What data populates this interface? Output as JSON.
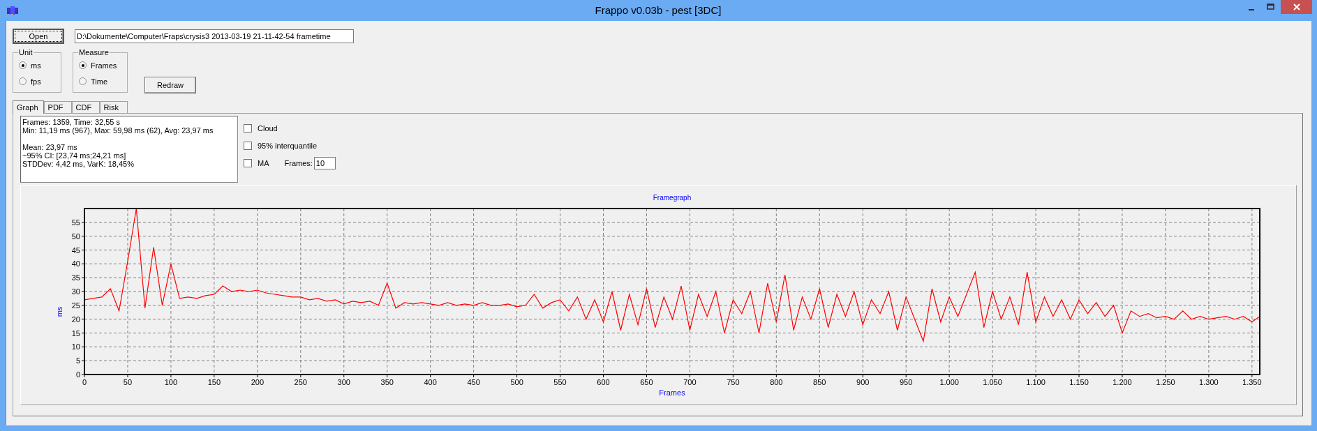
{
  "window": {
    "title": "Frappo v0.03b - pest [3DC]"
  },
  "open_button": {
    "label": "Open"
  },
  "file_path": {
    "value": "D:\\Dokumente\\Computer\\Fraps\\crysis3 2013-03-19 21-11-42-54 frametime"
  },
  "groups": [
    {
      "title": "Unit",
      "options": [
        {
          "label": "ms",
          "selected": true
        },
        {
          "label": "fps",
          "selected": false
        }
      ]
    },
    {
      "title": "Measure",
      "options": [
        {
          "label": "Frames",
          "selected": true
        },
        {
          "label": "Time",
          "selected": false
        }
      ]
    }
  ],
  "redraw_button": {
    "label": "Redraw"
  },
  "tabs": [
    {
      "label": "Graph",
      "selected": true
    },
    {
      "label": "PDF",
      "selected": false
    },
    {
      "label": "CDF",
      "selected": false
    },
    {
      "label": "Risk",
      "selected": false
    }
  ],
  "stats": {
    "blocks": [
      {
        "lines": [
          "Frames: 1359, Time: 32,55 s",
          "Min: 11,19 ms (967), Max: 59,98 ms (62), Avg: 23,97 ms"
        ]
      },
      {
        "lines": [
          "Mean: 23,97 ms",
          "~95% CI: [23,74 ms;24,21 ms]",
          "STDDev: 4,42 ms, VarK: 18,45%"
        ]
      }
    ]
  },
  "options": [
    {
      "label": "Cloud",
      "checked": false
    },
    {
      "label": "95% interquantile",
      "checked": false
    },
    {
      "label": "MA",
      "checked": false
    }
  ],
  "ma_frames": {
    "label": "Frames:",
    "value": "10"
  },
  "chart": {
    "chart_data": {
      "type": "line",
      "title": "Framegraph",
      "xlabel": "Frames",
      "ylabel": "ms",
      "x": [
        0,
        10,
        20,
        30,
        40,
        50,
        60,
        70,
        80,
        90,
        100,
        110,
        120,
        130,
        140,
        150,
        160,
        170,
        180,
        190,
        200,
        210,
        220,
        230,
        240,
        250,
        260,
        270,
        280,
        290,
        300,
        310,
        320,
        330,
        340,
        350,
        360,
        370,
        380,
        390,
        400,
        410,
        420,
        430,
        440,
        450,
        460,
        470,
        480,
        490,
        500,
        510,
        520,
        530,
        540,
        550,
        560,
        570,
        580,
        590,
        600,
        610,
        620,
        630,
        640,
        650,
        660,
        670,
        680,
        690,
        700,
        710,
        720,
        730,
        740,
        750,
        760,
        770,
        780,
        790,
        800,
        810,
        820,
        830,
        840,
        850,
        860,
        870,
        880,
        890,
        900,
        910,
        920,
        930,
        940,
        950,
        960,
        970,
        980,
        990,
        1000,
        1010,
        1020,
        1030,
        1040,
        1050,
        1060,
        1070,
        1080,
        1090,
        1100,
        1110,
        1120,
        1130,
        1140,
        1150,
        1160,
        1170,
        1180,
        1190,
        1200,
        1210,
        1220,
        1230,
        1240,
        1250,
        1260,
        1270,
        1280,
        1290,
        1300,
        1310,
        1320,
        1330,
        1340,
        1350,
        1359
      ],
      "series": [
        {
          "color": "#ff0000",
          "values": [
            27,
            27.5,
            28,
            31,
            23,
            41,
            60,
            24,
            46,
            25,
            40,
            27.5,
            28,
            27.5,
            28.5,
            29,
            32,
            30,
            30.5,
            30,
            30.5,
            29.5,
            29,
            28.5,
            28,
            28,
            27,
            27.5,
            26.5,
            27,
            25.5,
            26.5,
            26,
            26.5,
            25,
            33,
            24,
            26,
            25.5,
            26,
            25.5,
            25,
            26,
            25,
            25.5,
            25,
            26,
            25,
            25,
            25.5,
            24.5,
            25,
            29,
            24,
            26,
            27,
            23,
            28,
            20,
            27,
            19,
            30,
            16,
            29,
            18,
            31,
            17,
            28,
            20,
            32,
            16,
            29,
            21,
            30,
            15,
            27,
            22,
            30,
            15,
            33,
            19,
            36,
            16,
            28,
            20,
            31,
            17,
            29,
            21,
            30,
            18,
            27,
            22,
            30,
            16,
            28,
            20,
            12,
            31,
            19,
            28,
            21,
            29,
            37,
            17,
            30,
            20,
            28,
            18,
            37,
            19,
            28,
            21,
            27,
            20,
            27,
            22,
            26,
            21,
            25,
            15,
            23,
            21,
            22,
            20.5,
            21,
            20,
            23,
            20,
            21,
            20,
            20.5,
            21,
            20,
            21,
            19,
            21
          ]
        }
      ],
      "xlim": [
        0,
        1359
      ],
      "ylim": [
        0,
        60
      ],
      "grid": true,
      "xticks": [
        0,
        50,
        100,
        150,
        200,
        250,
        300,
        350,
        400,
        450,
        500,
        550,
        600,
        650,
        700,
        750,
        800,
        850,
        900,
        950,
        {
          "value": 1000,
          "label": "1.000"
        },
        {
          "value": 1050,
          "label": "1.050"
        },
        {
          "value": 1100,
          "label": "1.100"
        },
        {
          "value": 1150,
          "label": "1.150"
        },
        {
          "value": 1200,
          "label": "1.200"
        },
        {
          "value": 1250,
          "label": "1.250"
        },
        {
          "value": 1300,
          "label": "1.300"
        },
        {
          "value": 1350,
          "label": "1.350"
        }
      ],
      "yticks": [
        0,
        5,
        10,
        15,
        20,
        25,
        30,
        35,
        40,
        45,
        50,
        55
      ]
    }
  }
}
